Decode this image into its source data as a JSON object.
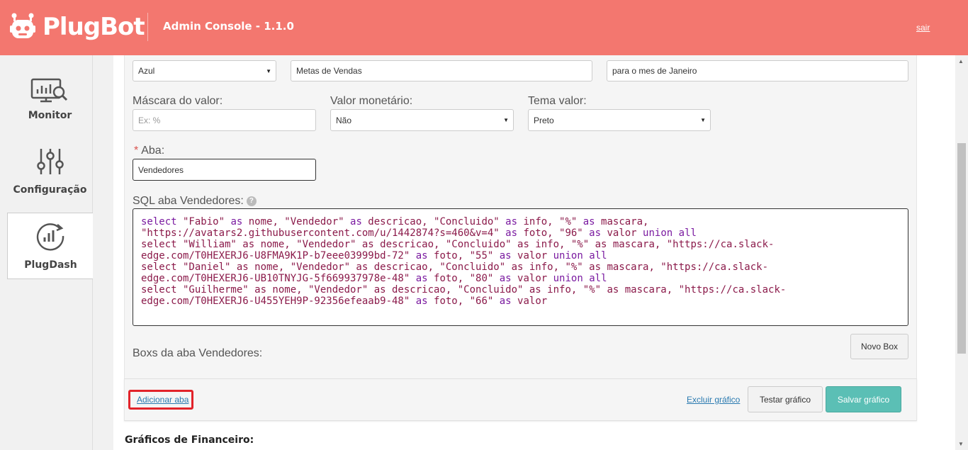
{
  "header": {
    "brand": "PlugBot",
    "app_title": "Admin Console - 1.1.0",
    "logout_label": "sair"
  },
  "sidebar": {
    "items": [
      {
        "label": "Monitor",
        "icon": "monitor-chart-icon"
      },
      {
        "label": "Configuração",
        "icon": "sliders-icon"
      },
      {
        "label": "PlugDash",
        "icon": "dashboard-chart-icon"
      }
    ]
  },
  "form": {
    "color_select": "Azul",
    "title_input": "Metas de Vendas",
    "subtitle_input": "para o mes de Janeiro",
    "mask_label": "Máscara do valor:",
    "mask_placeholder": "Ex: %",
    "currency_label": "Valor monetário:",
    "currency_select": "Não",
    "theme_label": "Tema valor:",
    "theme_select": "Preto",
    "tab_required": "*",
    "tab_label": "Aba:",
    "tab_input": "Vendedores",
    "sql_label": "SQL aba Vendedores:",
    "sql_help": "?",
    "sql_lines": [
      "select \"Fabio\" as nome, \"Vendedor\" as descricao, \"Concluido\" as info, \"%\" as mascara,",
      "\"https://avatars2.githubusercontent.com/u/1442874?s=460&v=4\" as foto, \"96\" as valor union all",
      "select \"William\" as nome, \"Vendedor\" as descricao, \"Concluido\" as info, \"%\" as mascara, \"https://ca.slack-",
      "edge.com/T0HEXERJ6-U8FMA9K1P-b7eee03999bd-72\" as foto, \"55\" as valor union all",
      "select \"Daniel\" as nome, \"Vendedor\" as descricao, \"Concluido\" as info, \"%\" as mascara, \"https://ca.slack-",
      "edge.com/T0HEXERJ6-UB10TNYJG-5f669937978e-48\" as foto, \"80\" as valor union all",
      "select \"Guilherme\" as nome, \"Vendedor\" as descricao, \"Concluido\" as info, \"%\" as mascara, \"https://ca.slack-",
      "edge.com/T0HEXERJ6-U455YEH9P-92356efeaab9-48\" as foto, \"66\" as valor"
    ],
    "boxes_label": "Boxs da aba Vendedores:",
    "new_box_button": "Novo Box"
  },
  "footer": {
    "add_tab_link": "Adicionar aba",
    "delete_chart_link": "Excluir gráfico",
    "test_chart_button": "Testar gráfico",
    "save_chart_button": "Salvar gráfico"
  },
  "next_section_title": "Gráficos de Financeiro:",
  "colors": {
    "header_bg": "#f3776f",
    "primary_button": "#5bbfb5",
    "highlight": "#e2232a"
  }
}
